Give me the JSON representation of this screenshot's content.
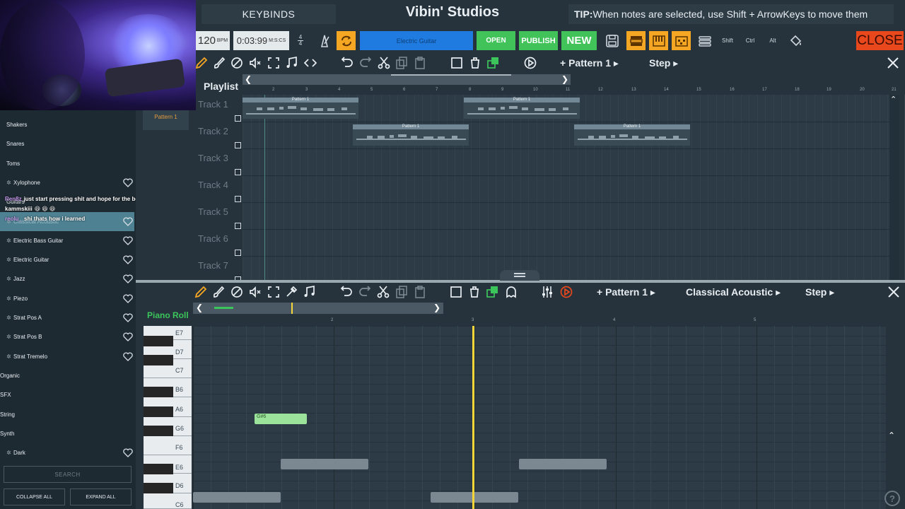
{
  "app": {
    "title": "Vibin' Studios",
    "keybinds_label": "KEYBINDS",
    "tip_prefix": "TIP:",
    "tip_text": " When notes are selected, use Shift + ArrowKeys to move them"
  },
  "toolbar": {
    "bpm_value": "120",
    "bpm_unit": "BPM",
    "time_value": "0:03:99",
    "time_unit": "M:S:CS",
    "sig_top": "4",
    "sig_bottom": "4",
    "instrument": "Electric Guitar",
    "open_label": "OPEN",
    "publish_label": "PUBLISH",
    "new_label": "NEW",
    "shift_label": "Shift",
    "ctrl_label": "Ctrl",
    "alt_label": "Alt",
    "close_label": "CLOSE"
  },
  "playlist": {
    "title": "Playlist",
    "pattern_label": "Pattern 1",
    "step_label": "Step",
    "pattern_list_item": "Pattern 1",
    "ruler": [
      "2",
      "3",
      "4",
      "5",
      "6",
      "7",
      "8",
      "9",
      "10",
      "11",
      "12",
      "13",
      "14",
      "15",
      "16",
      "17",
      "18",
      "19",
      "20",
      "21"
    ],
    "tracks": [
      "Track 1",
      "Track 2",
      "Track 3",
      "Track 4",
      "Track 5",
      "Track 6",
      "Track 7"
    ],
    "clip_label": "Pattern 1"
  },
  "piano_roll": {
    "title": "Piano Roll",
    "pattern_label": "Pattern 1",
    "instrument_label": "Classical Acoustic",
    "step_label": "Step",
    "ruler": [
      "2",
      "3",
      "4",
      "5"
    ],
    "keys": [
      "E7",
      "D7",
      "C7",
      "B6",
      "A6",
      "G6",
      "F6",
      "E6",
      "D6",
      "C6"
    ],
    "selected_note": "G#6"
  },
  "sidebar": {
    "rows": [
      {
        "label": "Shakers",
        "type": "cat",
        "fav": false
      },
      {
        "label": "Snares",
        "type": "cat",
        "fav": false
      },
      {
        "label": "Toms",
        "type": "cat",
        "fav": false
      },
      {
        "label": "Xylophone",
        "type": "item",
        "fav": true
      },
      {
        "label": "Guitars",
        "type": "cat",
        "fav": false
      },
      {
        "label": "Classical Acoustic",
        "type": "item-selected",
        "fav": true
      },
      {
        "label": "Electric Bass Guitar",
        "type": "item",
        "fav": true
      },
      {
        "label": "Electric Guitar",
        "type": "item",
        "fav": true
      },
      {
        "label": "Jazz",
        "type": "item",
        "fav": true
      },
      {
        "label": "Piezo",
        "type": "item",
        "fav": true
      },
      {
        "label": "Strat Pos A",
        "type": "item",
        "fav": true
      },
      {
        "label": "Strat Pos B",
        "type": "item",
        "fav": true
      },
      {
        "label": "Strat Tremelo",
        "type": "item",
        "fav": true
      },
      {
        "label": "Organic",
        "type": "top",
        "fav": false
      },
      {
        "label": "SFX",
        "type": "top",
        "fav": false
      },
      {
        "label": "String",
        "type": "top",
        "fav": false
      },
      {
        "label": "Synth",
        "type": "top",
        "fav": false
      },
      {
        "label": "Dark",
        "type": "item",
        "fav": true
      }
    ],
    "search_label": "SEARCH",
    "collapse_label": "COLLAPSE ALL",
    "expand_label": "EXPAND ALL"
  },
  "chat": [
    {
      "user": "Ren8z",
      "text": "just start pressing shit and hope for the best"
    },
    {
      "user": "kammskiii",
      "text": "😆 😆 😆"
    },
    {
      "user": "reolu_",
      "text": "shi thats how i learned"
    }
  ],
  "colors": {
    "accent_blue": "#1f7be0",
    "accent_green": "#41c35a",
    "close_red": "#e8481c",
    "loop_orange": "#f5a623",
    "playhead": "#f4d63a",
    "selected_note": "#9be39a"
  }
}
